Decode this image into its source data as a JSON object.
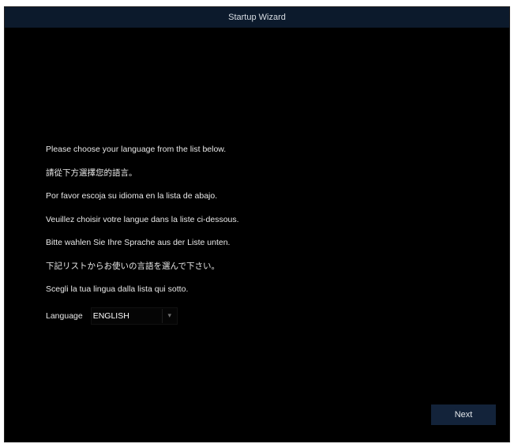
{
  "window": {
    "title": "Startup Wizard"
  },
  "instructions": [
    "Please choose your language from the list below.",
    "請從下方選擇您的語言。",
    "Por favor escoja su idioma en la lista de abajo.",
    "Veuillez choisir votre langue dans la liste ci-dessous.",
    "Bitte wahlen Sie Ihre Sprache aus der Liste unten.",
    "下記リストからお使いの言語を選んで下さい。",
    "Scegli la tua lingua dalla lista qui sotto."
  ],
  "language": {
    "label": "Language",
    "selected": "ENGLISH"
  },
  "footer": {
    "next_label": "Next"
  },
  "colors": {
    "background": "#000000",
    "titlebar": "#0c1a2c",
    "button": "#13233a"
  }
}
